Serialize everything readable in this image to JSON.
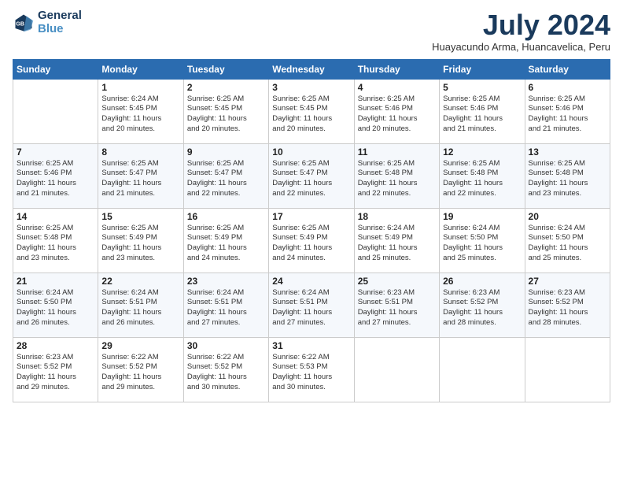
{
  "logo": {
    "line1": "General",
    "line2": "Blue"
  },
  "title": "July 2024",
  "subtitle": "Huayacundo Arma, Huancavelica, Peru",
  "days_header": [
    "Sunday",
    "Monday",
    "Tuesday",
    "Wednesday",
    "Thursday",
    "Friday",
    "Saturday"
  ],
  "weeks": [
    [
      {
        "day": "",
        "info": ""
      },
      {
        "day": "1",
        "info": "Sunrise: 6:24 AM\nSunset: 5:45 PM\nDaylight: 11 hours\nand 20 minutes."
      },
      {
        "day": "2",
        "info": "Sunrise: 6:25 AM\nSunset: 5:45 PM\nDaylight: 11 hours\nand 20 minutes."
      },
      {
        "day": "3",
        "info": "Sunrise: 6:25 AM\nSunset: 5:45 PM\nDaylight: 11 hours\nand 20 minutes."
      },
      {
        "day": "4",
        "info": "Sunrise: 6:25 AM\nSunset: 5:46 PM\nDaylight: 11 hours\nand 20 minutes."
      },
      {
        "day": "5",
        "info": "Sunrise: 6:25 AM\nSunset: 5:46 PM\nDaylight: 11 hours\nand 21 minutes."
      },
      {
        "day": "6",
        "info": "Sunrise: 6:25 AM\nSunset: 5:46 PM\nDaylight: 11 hours\nand 21 minutes."
      }
    ],
    [
      {
        "day": "7",
        "info": "Sunrise: 6:25 AM\nSunset: 5:46 PM\nDaylight: 11 hours\nand 21 minutes."
      },
      {
        "day": "8",
        "info": "Sunrise: 6:25 AM\nSunset: 5:47 PM\nDaylight: 11 hours\nand 21 minutes."
      },
      {
        "day": "9",
        "info": "Sunrise: 6:25 AM\nSunset: 5:47 PM\nDaylight: 11 hours\nand 22 minutes."
      },
      {
        "day": "10",
        "info": "Sunrise: 6:25 AM\nSunset: 5:47 PM\nDaylight: 11 hours\nand 22 minutes."
      },
      {
        "day": "11",
        "info": "Sunrise: 6:25 AM\nSunset: 5:48 PM\nDaylight: 11 hours\nand 22 minutes."
      },
      {
        "day": "12",
        "info": "Sunrise: 6:25 AM\nSunset: 5:48 PM\nDaylight: 11 hours\nand 22 minutes."
      },
      {
        "day": "13",
        "info": "Sunrise: 6:25 AM\nSunset: 5:48 PM\nDaylight: 11 hours\nand 23 minutes."
      }
    ],
    [
      {
        "day": "14",
        "info": "Sunrise: 6:25 AM\nSunset: 5:48 PM\nDaylight: 11 hours\nand 23 minutes."
      },
      {
        "day": "15",
        "info": "Sunrise: 6:25 AM\nSunset: 5:49 PM\nDaylight: 11 hours\nand 23 minutes."
      },
      {
        "day": "16",
        "info": "Sunrise: 6:25 AM\nSunset: 5:49 PM\nDaylight: 11 hours\nand 24 minutes."
      },
      {
        "day": "17",
        "info": "Sunrise: 6:25 AM\nSunset: 5:49 PM\nDaylight: 11 hours\nand 24 minutes."
      },
      {
        "day": "18",
        "info": "Sunrise: 6:24 AM\nSunset: 5:49 PM\nDaylight: 11 hours\nand 25 minutes."
      },
      {
        "day": "19",
        "info": "Sunrise: 6:24 AM\nSunset: 5:50 PM\nDaylight: 11 hours\nand 25 minutes."
      },
      {
        "day": "20",
        "info": "Sunrise: 6:24 AM\nSunset: 5:50 PM\nDaylight: 11 hours\nand 25 minutes."
      }
    ],
    [
      {
        "day": "21",
        "info": "Sunrise: 6:24 AM\nSunset: 5:50 PM\nDaylight: 11 hours\nand 26 minutes."
      },
      {
        "day": "22",
        "info": "Sunrise: 6:24 AM\nSunset: 5:51 PM\nDaylight: 11 hours\nand 26 minutes."
      },
      {
        "day": "23",
        "info": "Sunrise: 6:24 AM\nSunset: 5:51 PM\nDaylight: 11 hours\nand 27 minutes."
      },
      {
        "day": "24",
        "info": "Sunrise: 6:24 AM\nSunset: 5:51 PM\nDaylight: 11 hours\nand 27 minutes."
      },
      {
        "day": "25",
        "info": "Sunrise: 6:23 AM\nSunset: 5:51 PM\nDaylight: 11 hours\nand 27 minutes."
      },
      {
        "day": "26",
        "info": "Sunrise: 6:23 AM\nSunset: 5:52 PM\nDaylight: 11 hours\nand 28 minutes."
      },
      {
        "day": "27",
        "info": "Sunrise: 6:23 AM\nSunset: 5:52 PM\nDaylight: 11 hours\nand 28 minutes."
      }
    ],
    [
      {
        "day": "28",
        "info": "Sunrise: 6:23 AM\nSunset: 5:52 PM\nDaylight: 11 hours\nand 29 minutes."
      },
      {
        "day": "29",
        "info": "Sunrise: 6:22 AM\nSunset: 5:52 PM\nDaylight: 11 hours\nand 29 minutes."
      },
      {
        "day": "30",
        "info": "Sunrise: 6:22 AM\nSunset: 5:52 PM\nDaylight: 11 hours\nand 30 minutes."
      },
      {
        "day": "31",
        "info": "Sunrise: 6:22 AM\nSunset: 5:53 PM\nDaylight: 11 hours\nand 30 minutes."
      },
      {
        "day": "",
        "info": ""
      },
      {
        "day": "",
        "info": ""
      },
      {
        "day": "",
        "info": ""
      }
    ]
  ]
}
